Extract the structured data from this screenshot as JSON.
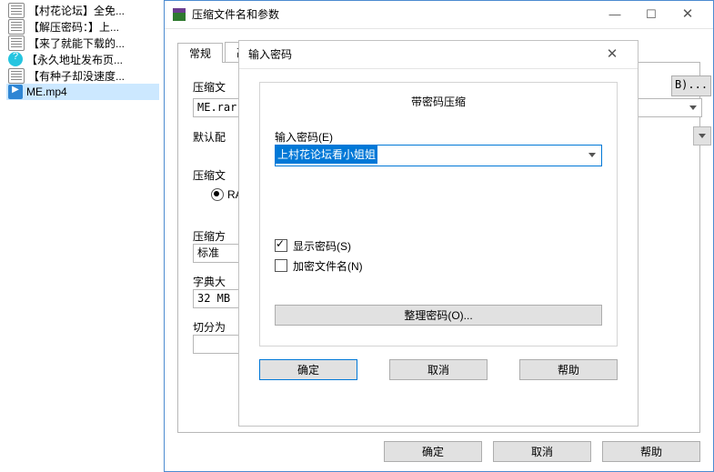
{
  "files": [
    {
      "kind": "txt",
      "name": "【村花论坛】全免..."
    },
    {
      "kind": "txt",
      "name": "【解压密码：】上..."
    },
    {
      "kind": "txt",
      "name": "【来了就能下载的..."
    },
    {
      "kind": "round",
      "name": "【永久地址发布页..."
    },
    {
      "kind": "txt",
      "name": "【有种子却没速度..."
    },
    {
      "kind": "vid",
      "name": "ME.mp4",
      "selected": true
    }
  ],
  "d1": {
    "title": "压缩文件名和参数",
    "tabs": [
      "常规",
      "高"
    ],
    "labels": {
      "fname": "压缩文",
      "default": "默认配",
      "fmt": "压缩文",
      "method": "压缩方",
      "dict": "字典大",
      "split": "切分为"
    },
    "filename": "ME.rar",
    "browse": "B)...",
    "radio": "RAR",
    "method": "标准",
    "dict": "32 MB",
    "split": "",
    "ok": "确定",
    "cancel": "取消",
    "help": "帮助"
  },
  "d2": {
    "title": "输入密码",
    "group_title": "带密码压缩",
    "pwd_label": "输入密码(E)",
    "password": "上村花论坛看小姐姐",
    "show_pwd": "显示密码(S)",
    "encrypt_name": "加密文件名(N)",
    "org": "整理密码(O)...",
    "ok": "确定",
    "cancel": "取消",
    "help": "帮助"
  }
}
